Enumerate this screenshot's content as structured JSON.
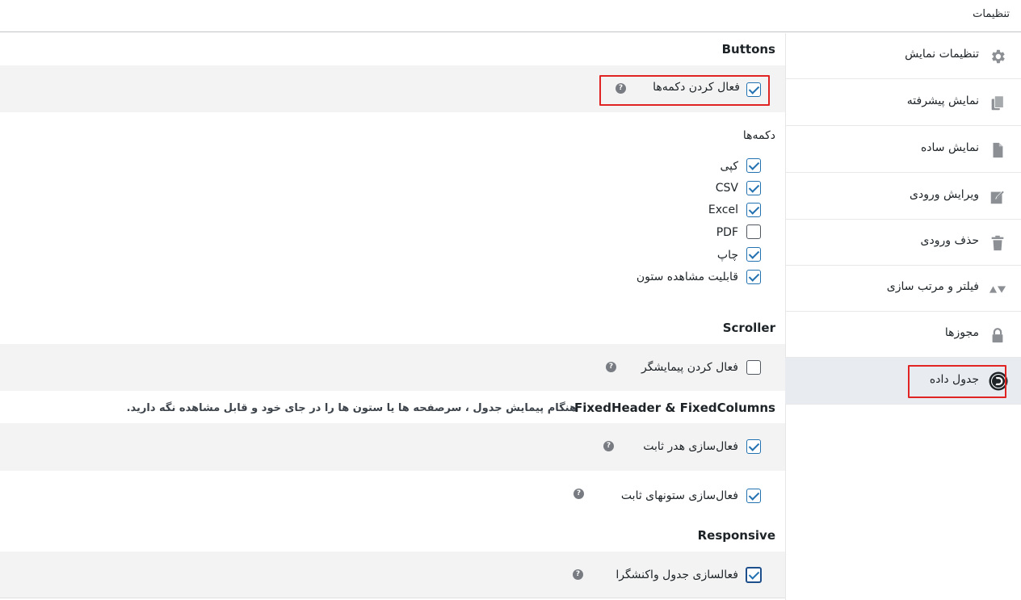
{
  "header": {
    "title": "تنظیمات"
  },
  "sidebar": {
    "items": [
      {
        "label": "تنظیمات نمایش",
        "icon": "gear-icon"
      },
      {
        "label": "نمایش پیشرفته",
        "icon": "copy-icon"
      },
      {
        "label": "نمایش ساده",
        "icon": "document-icon"
      },
      {
        "label": "ویرایش ورودی",
        "icon": "edit-icon"
      },
      {
        "label": "حذف ورودی",
        "icon": "trash-icon"
      },
      {
        "label": "فیلتر و مرتب سازی",
        "icon": "sort-icon"
      },
      {
        "label": "مجوزها",
        "icon": "lock-icon"
      },
      {
        "label": "جدول داده",
        "icon": "datatable-icon",
        "active": true
      }
    ]
  },
  "buttons_section": {
    "title": "Buttons",
    "enable_label": "فعال کردن دکمه‌ها",
    "enable_checked": true,
    "list_title": "دکمه‌ها",
    "options": [
      {
        "label": "کپی",
        "checked": true
      },
      {
        "label": "CSV",
        "checked": true
      },
      {
        "label": "Excel",
        "checked": true
      },
      {
        "label": "PDF",
        "checked": false
      },
      {
        "label": "چاپ",
        "checked": true
      },
      {
        "label": "قابلیت مشاهده ستون",
        "checked": true
      }
    ]
  },
  "scroller_section": {
    "title": "Scroller",
    "enable_label": "فعال کردن پیمایشگر",
    "enable_checked": false
  },
  "fixed_section": {
    "title": "FixedHeader & FixedColumns",
    "description": "هنگام پیمایش جدول ، سرصفحه ها یا ستون ها را در جای خود و قابل مشاهده نگه دارید.",
    "header_label": "فعال‌سازی هدر ثابت",
    "header_checked": true,
    "columns_label": "فعال‌سازی ستونهای ثابت",
    "columns_checked": true
  },
  "responsive_section": {
    "title": "Responsive",
    "enable_label": "فعالسازی جدول واکنشگرا",
    "enable_checked": true
  },
  "help_glyph": "?",
  "colors": {
    "accent": "#2271b1",
    "highlight": "#e02424",
    "active_bg": "#e8ebef",
    "band_bg": "#f3f3f3"
  }
}
